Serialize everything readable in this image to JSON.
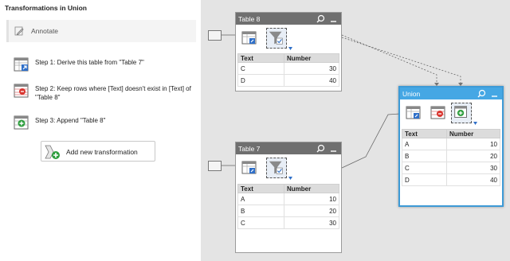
{
  "panel": {
    "title": "Transformations in Union",
    "annotate_label": "Annotate",
    "steps": [
      {
        "label": "Step 1: Derive this table from \"Table 7\"",
        "icon": "derive-table-icon"
      },
      {
        "label": "Step 2: Keep rows where [Text] doesn't exist in [Text] of \"Table 8\"",
        "icon": "filter-rows-icon"
      },
      {
        "label": "Step 3: Append \"Table 8\"",
        "icon": "append-table-icon"
      }
    ],
    "add_button_label": "Add new transformation"
  },
  "tables": {
    "table8": {
      "name": "Table 8",
      "columns": [
        "Text",
        "Number"
      ],
      "rows": [
        [
          "C",
          "30"
        ],
        [
          "D",
          "40"
        ]
      ]
    },
    "table7": {
      "name": "Table 7",
      "columns": [
        "Text",
        "Number"
      ],
      "rows": [
        [
          "A",
          "10"
        ],
        [
          "B",
          "20"
        ],
        [
          "C",
          "30"
        ]
      ]
    },
    "union": {
      "name": "Union",
      "columns": [
        "Text",
        "Number"
      ],
      "rows": [
        [
          "A",
          "10"
        ],
        [
          "B",
          "20"
        ],
        [
          "C",
          "30"
        ],
        [
          "D",
          "40"
        ]
      ]
    }
  },
  "colors": {
    "header_gray": "#6f6f6f",
    "header_selected": "#45a7e4",
    "canvas": "#e4e4e4",
    "append_green": "#2e9e3e",
    "filter_red": "#d9352f"
  }
}
